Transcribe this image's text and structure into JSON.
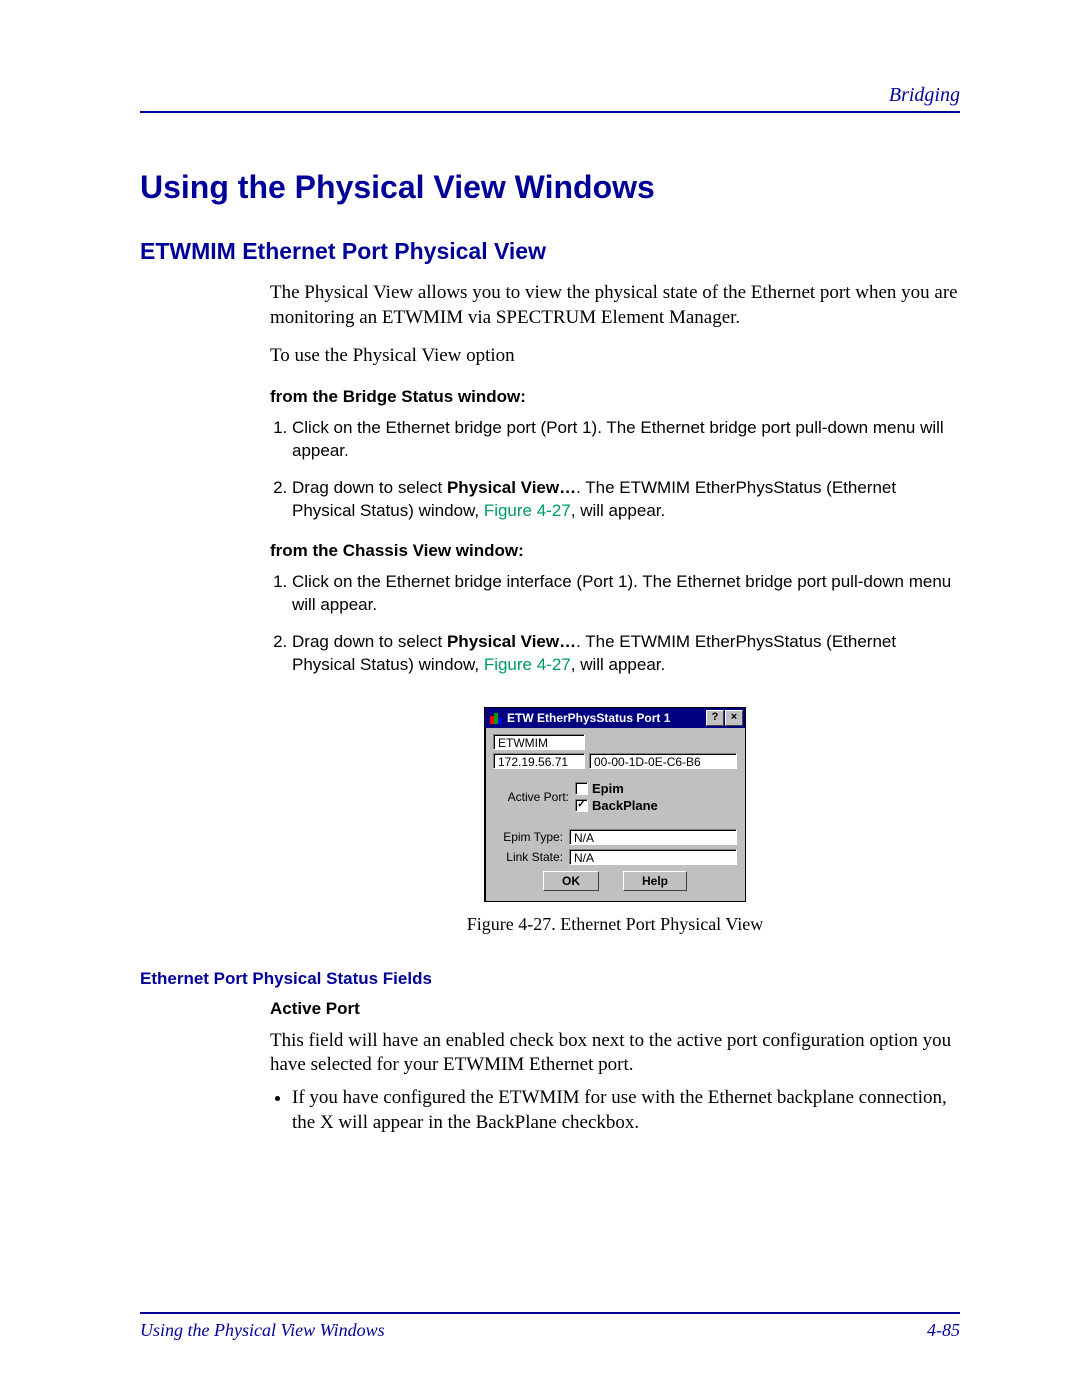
{
  "header": {
    "right": "Bridging"
  },
  "h1": "Using the Physical View Windows",
  "h2": "ETWMIM Ethernet Port Physical View",
  "intro": "The Physical View allows you to view the physical state of the Ethernet port when you are monitoring an ETWMIM via SPECTRUM Element Manager.",
  "lead2": "To use the Physical View option",
  "sec1": {
    "title": "from the Bridge Status window:",
    "items": [
      {
        "pre": "Click on the Ethernet bridge port (Port 1). The Ethernet bridge port pull-down menu will appear."
      },
      {
        "pre": "Drag down to select ",
        "bold": "Physical View…",
        "mid": ". The ETWMIM EtherPhysStatus (Ethernet Physical Status) window, ",
        "fig": "Figure 4-27",
        "post": ", will appear."
      }
    ]
  },
  "sec2": {
    "title": "from the Chassis View window:",
    "items": [
      {
        "pre": "Click on the Ethernet bridge interface (Port 1). The Ethernet bridge port pull-down menu will appear."
      },
      {
        "pre": "Drag down to select ",
        "bold": "Physical View…",
        "mid": ". The ETWMIM EtherPhysStatus (Ethernet Physical Status) window, ",
        "fig": "Figure 4-27",
        "post": ", will appear."
      }
    ]
  },
  "dialog": {
    "title": "ETW EtherPhysStatus Port 1",
    "name": "ETWMIM",
    "ip": "172.19.56.71",
    "mac": "00-00-1D-0E-C6-B6",
    "activePortLabel": "Active Port:",
    "epimLabel": "Epim",
    "backplaneLabel": "BackPlane",
    "epimChecked": "",
    "backplaneChecked": "✓",
    "epimTypeLabel": "Epim Type:",
    "epimTypeValue": "N/A",
    "linkStateLabel": "Link State:",
    "linkStateValue": "N/A",
    "ok": "OK",
    "help": "Help",
    "helpBtn": "?",
    "closeBtn": "×"
  },
  "caption": "Figure 4-27. Ethernet Port Physical View",
  "fieldsHeading": "Ethernet Port Physical Status Fields",
  "activePort": {
    "label": "Active Port",
    "text": "This field will have an enabled check box next to the active port configuration option you have selected for your ETWMIM Ethernet port.",
    "bullet": "If you have configured the ETWMIM for use with the Ethernet backplane connection, the X will appear in the BackPlane checkbox."
  },
  "footer": {
    "left": "Using the Physical View Windows",
    "right": "4-85"
  }
}
